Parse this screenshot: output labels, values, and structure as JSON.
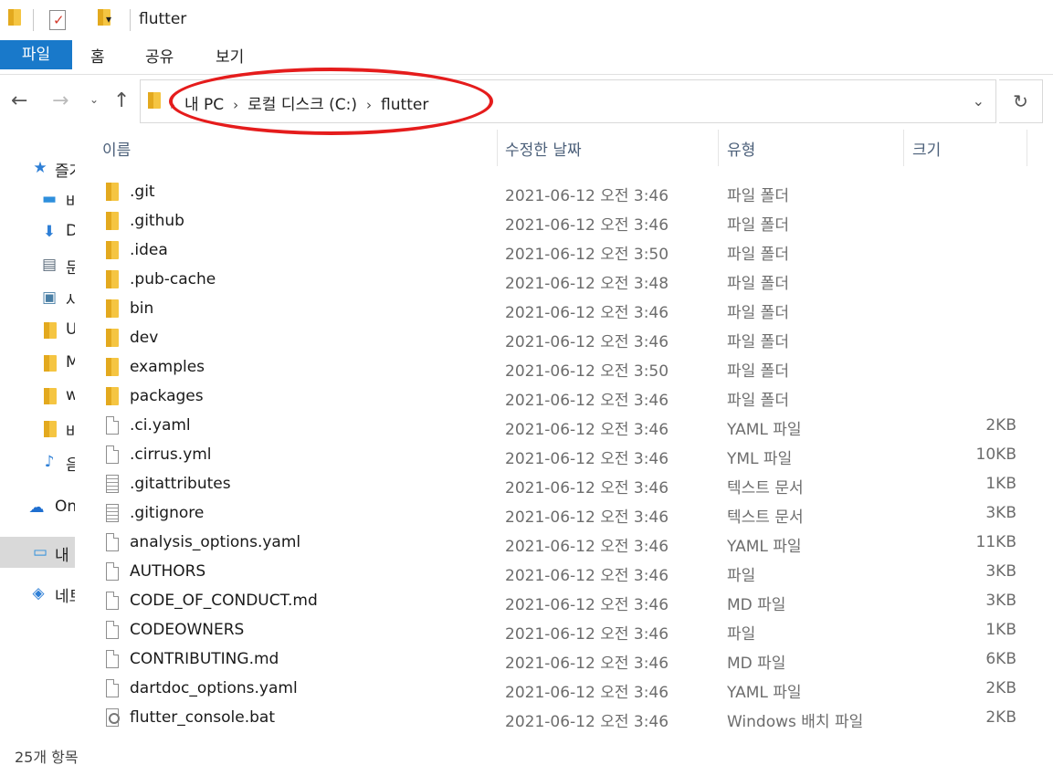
{
  "window": {
    "title": "flutter"
  },
  "quick_access": {
    "dropdown_glyph": "▾",
    "icons": [
      "folder-icon",
      "properties-icon",
      "new-folder-icon"
    ]
  },
  "ribbon": {
    "tabs": [
      "파일",
      "홈",
      "공유",
      "보기"
    ],
    "accent": "#1979ca"
  },
  "nav": {
    "back_glyph": "←",
    "forward_glyph": "→",
    "recent_glyph": "⌄",
    "up_glyph": "↑",
    "refresh_glyph": "↻"
  },
  "address": {
    "crumbs": [
      "내 PC",
      "로컬 디스크 (C:)",
      "flutter"
    ],
    "chevron": "›",
    "dropdown_glyph": "⌄",
    "annotation_color": "#e51c1c"
  },
  "sidebar": {
    "items": [
      {
        "label": "즐겨찾기",
        "icon": "star-icon",
        "glyph": "★",
        "color": "#2e7fd6"
      },
      {
        "label": "바탕 화면",
        "icon": "desktop-icon",
        "glyph": "▬",
        "color": "#2e8fdc"
      },
      {
        "label": "Downloads",
        "icon": "download-icon",
        "glyph": "⬇",
        "color": "#2e7fd6"
      },
      {
        "label": "문서",
        "icon": "document-icon",
        "glyph": "▤",
        "color": "#5a6a7a"
      },
      {
        "label": "사진",
        "icon": "picture-icon",
        "glyph": "▣",
        "color": "#4a7fa6"
      },
      {
        "label": "Users",
        "icon": "folder-icon",
        "glyph": "",
        "color": "#f5c542"
      },
      {
        "label": "My",
        "icon": "folder-icon",
        "glyph": "",
        "color": "#f5c542"
      },
      {
        "label": "work",
        "icon": "folder-icon",
        "glyph": "",
        "color": "#f5c542"
      },
      {
        "label": "바탕",
        "icon": "folder-icon",
        "glyph": "",
        "color": "#f5c542"
      },
      {
        "label": "음악",
        "icon": "music-icon",
        "glyph": "♪",
        "color": "#2e7fd6"
      },
      {
        "label": "OneDrive",
        "icon": "cloud-icon",
        "glyph": "☁",
        "color": "#1f6fd0"
      },
      {
        "label": "내 PC",
        "icon": "computer-icon",
        "glyph": "▭",
        "color": "#2e8fdc"
      },
      {
        "label": "네트워크",
        "icon": "network-icon",
        "glyph": "◈",
        "color": "#2e7fd6"
      }
    ]
  },
  "columns": {
    "name": "이름",
    "date": "수정한 날짜",
    "type": "유형",
    "size": "크기",
    "sort_caret": "^"
  },
  "files": [
    {
      "name": ".git",
      "date": "2021-06-12 오전 3:46",
      "type": "파일 폴더",
      "size": "",
      "kind": "folder"
    },
    {
      "name": ".github",
      "date": "2021-06-12 오전 3:46",
      "type": "파일 폴더",
      "size": "",
      "kind": "folder"
    },
    {
      "name": ".idea",
      "date": "2021-06-12 오전 3:50",
      "type": "파일 폴더",
      "size": "",
      "kind": "folder"
    },
    {
      "name": ".pub-cache",
      "date": "2021-06-12 오전 3:48",
      "type": "파일 폴더",
      "size": "",
      "kind": "folder"
    },
    {
      "name": "bin",
      "date": "2021-06-12 오전 3:46",
      "type": "파일 폴더",
      "size": "",
      "kind": "folder"
    },
    {
      "name": "dev",
      "date": "2021-06-12 오전 3:46",
      "type": "파일 폴더",
      "size": "",
      "kind": "folder"
    },
    {
      "name": "examples",
      "date": "2021-06-12 오전 3:50",
      "type": "파일 폴더",
      "size": "",
      "kind": "folder"
    },
    {
      "name": "packages",
      "date": "2021-06-12 오전 3:46",
      "type": "파일 폴더",
      "size": "",
      "kind": "folder"
    },
    {
      "name": ".ci.yaml",
      "date": "2021-06-12 오전 3:46",
      "type": "YAML 파일",
      "size": "2KB",
      "kind": "file"
    },
    {
      "name": ".cirrus.yml",
      "date": "2021-06-12 오전 3:46",
      "type": "YML 파일",
      "size": "10KB",
      "kind": "file"
    },
    {
      "name": ".gitattributes",
      "date": "2021-06-12 오전 3:46",
      "type": "텍스트 문서",
      "size": "1KB",
      "kind": "text"
    },
    {
      "name": ".gitignore",
      "date": "2021-06-12 오전 3:46",
      "type": "텍스트 문서",
      "size": "3KB",
      "kind": "text"
    },
    {
      "name": "analysis_options.yaml",
      "date": "2021-06-12 오전 3:46",
      "type": "YAML 파일",
      "size": "11KB",
      "kind": "file"
    },
    {
      "name": "AUTHORS",
      "date": "2021-06-12 오전 3:46",
      "type": "파일",
      "size": "3KB",
      "kind": "file"
    },
    {
      "name": "CODE_OF_CONDUCT.md",
      "date": "2021-06-12 오전 3:46",
      "type": "MD 파일",
      "size": "3KB",
      "kind": "file"
    },
    {
      "name": "CODEOWNERS",
      "date": "2021-06-12 오전 3:46",
      "type": "파일",
      "size": "1KB",
      "kind": "file"
    },
    {
      "name": "CONTRIBUTING.md",
      "date": "2021-06-12 오전 3:46",
      "type": "MD 파일",
      "size": "6KB",
      "kind": "file"
    },
    {
      "name": "dartdoc_options.yaml",
      "date": "2021-06-12 오전 3:46",
      "type": "YAML 파일",
      "size": "2KB",
      "kind": "file"
    },
    {
      "name": "flutter_console.bat",
      "date": "2021-06-12 오전 3:46",
      "type": "Windows 배치 파일",
      "size": "2KB",
      "kind": "bat"
    }
  ],
  "status": {
    "item_count": "25개 항목"
  }
}
